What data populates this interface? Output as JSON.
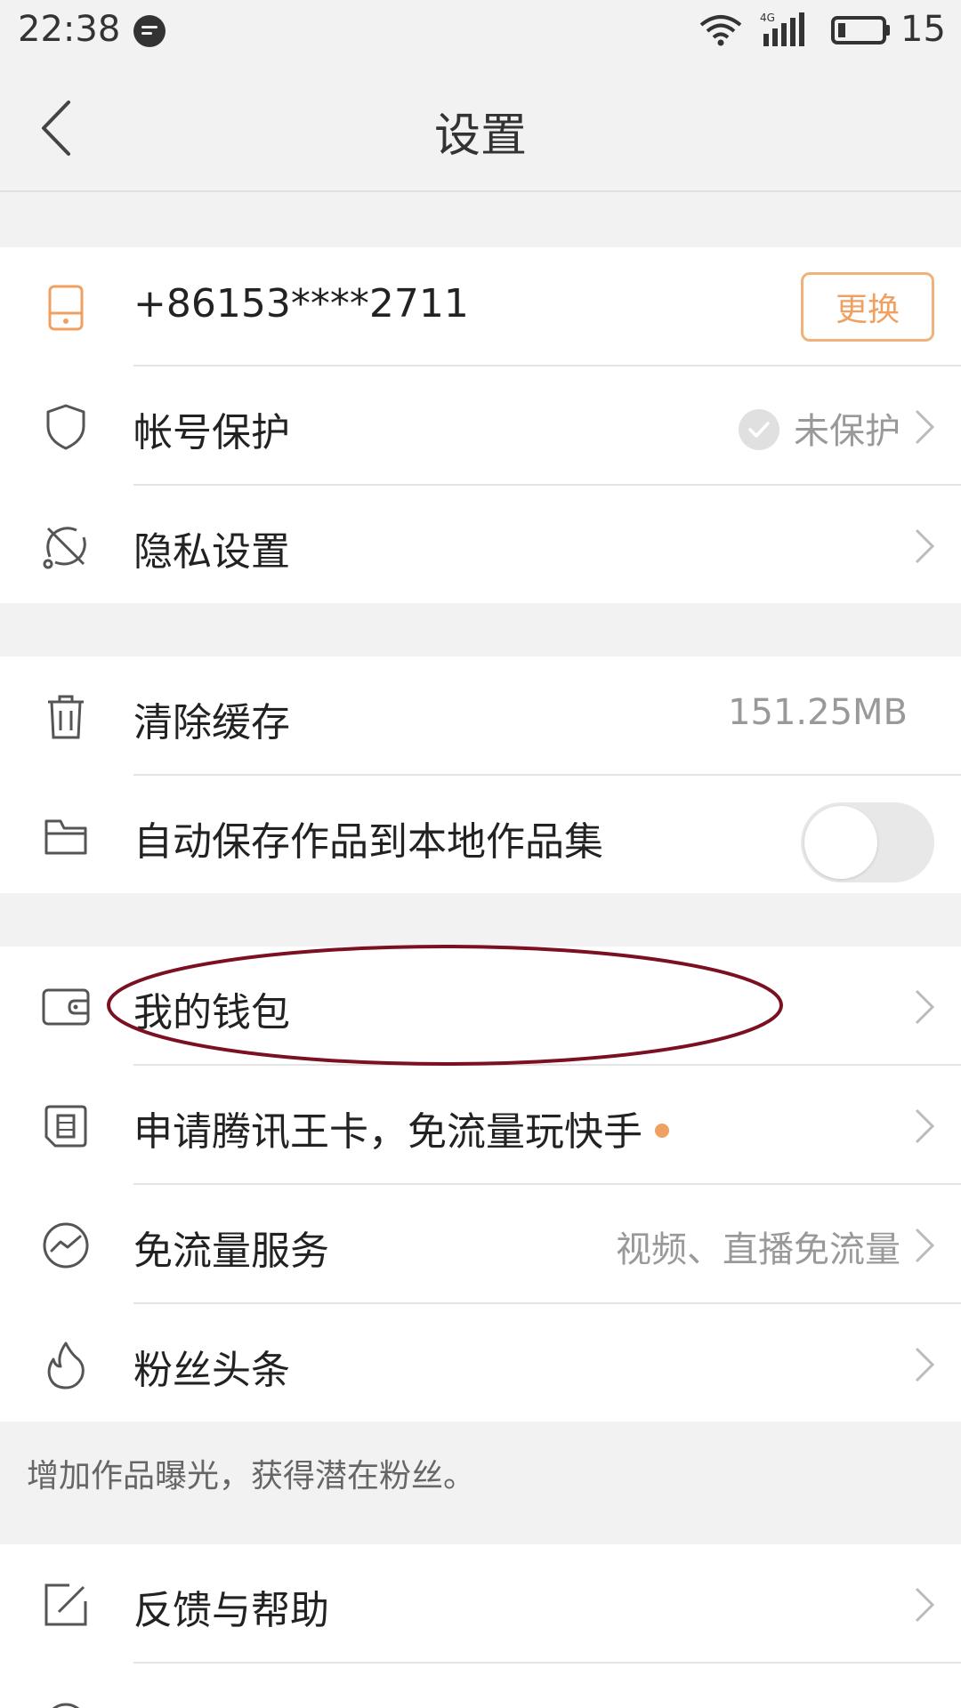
{
  "status_bar": {
    "time": "22:38",
    "battery_level": "15",
    "network": "4G",
    "icons": [
      "message-icon",
      "wifi-icon",
      "signal-icon",
      "battery-icon"
    ]
  },
  "header": {
    "title": "设置",
    "back_icon": "back-arrow-icon"
  },
  "account": {
    "phone": "+86153****2711",
    "change_label": "更换",
    "protection_label": "帐号保护",
    "protection_status": "未保护",
    "privacy_label": "隐私设置"
  },
  "storage": {
    "clear_cache_label": "清除缓存",
    "cache_size": "151.25MB",
    "auto_save_label": "自动保存作品到本地作品集",
    "auto_save_enabled": false
  },
  "services": {
    "wallet_label": "我的钱包",
    "tencent_card_label": "申请腾讯王卡，免流量玩快手",
    "free_data_label": "免流量服务",
    "free_data_value": "视频、直播免流量",
    "fans_headline_label": "粉丝头条",
    "fans_hint": "增加作品曝光，获得潜在粉丝。"
  },
  "help": {
    "feedback_label": "反馈与帮助"
  },
  "colors": {
    "accent": "#f0a060",
    "annotation": "#7a1020",
    "background": "#f2f2f2"
  }
}
